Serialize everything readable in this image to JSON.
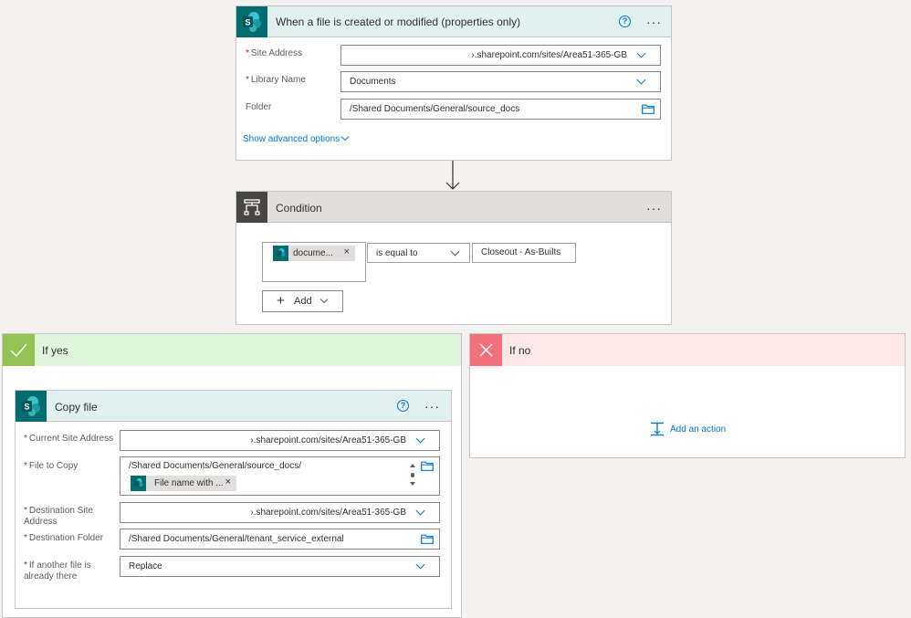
{
  "trigger": {
    "title": "When a file is created or modified (properties only)",
    "help": "?",
    "more": "···",
    "fields": [
      {
        "label": "Site Address",
        "required": true,
        "value": "›.sharepoint.com/sites/Area51-365-GB"
      },
      {
        "label": "Library Name",
        "required": true,
        "value": "Documents"
      },
      {
        "label": "Folder",
        "required": false,
        "value": "/Shared Documents/General/source_docs"
      }
    ],
    "advanced_link": "Show advanced options"
  },
  "condition": {
    "title": "Condition",
    "more": "···",
    "token_text": "docume...",
    "token_remove": "×",
    "operator": "is equal to",
    "value": "Closeout - As-Builts",
    "add_button": "Add",
    "add_plus": "+"
  },
  "if_yes": {
    "title": "If yes",
    "action": {
      "title": "Copy file",
      "help": "?",
      "more": "···",
      "current_site_label": "Current Site Address",
      "current_site_value": "›.sharepoint.com/sites/Area51-365-GB",
      "file_to_copy_label": "File to Copy",
      "file_to_copy_path": "/Shared Documents/General/source_docs/",
      "file_token_text": "File name with ...",
      "file_token_remove": "×",
      "dest_site_label_1": "Destination Site",
      "dest_site_label_2": "Address",
      "dest_site_value": "›.sharepoint.com/sites/Area51-365-GB",
      "dest_folder_label": "Destination Folder",
      "dest_folder_value": "/Shared Documents/General/tenant_service_external",
      "conflict_label_1": "If another file is",
      "conflict_label_2": "already there",
      "conflict_value": "Replace"
    }
  },
  "if_no": {
    "title": "If no",
    "add_action": "Add an action"
  },
  "colors": {
    "sharepoint": "#036c70",
    "accent": "#0078d4",
    "yes_header": "#dff6dd",
    "yes_icon": "#92c353",
    "no_header": "#fde7e9",
    "no_icon": "#f1707b",
    "condition_icon": "#484644"
  }
}
